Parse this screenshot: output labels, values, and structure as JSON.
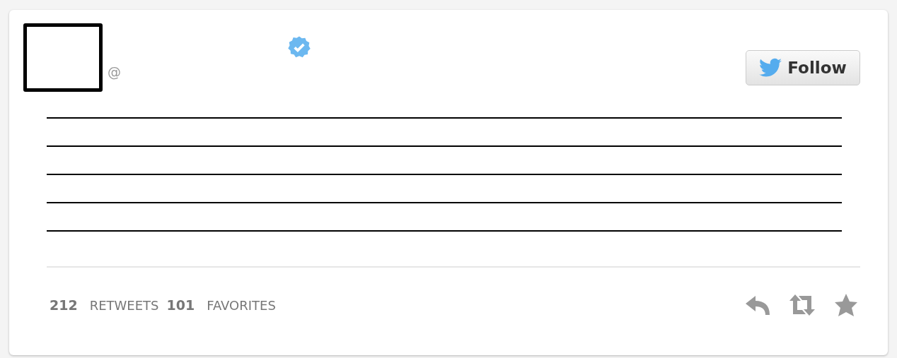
{
  "tweet": {
    "handle": "@",
    "verified": true,
    "follow_button": {
      "label": "Follow"
    },
    "body_lines": [
      {
        "kind": "blank"
      },
      {
        "kind": "blank"
      },
      {
        "kind": "blank"
      },
      {
        "kind": "blank"
      },
      {
        "kind": "blank"
      }
    ],
    "stats": [
      {
        "count": "212",
        "label": "RETWEETS"
      },
      {
        "count": "101",
        "label": "FAVORITES"
      }
    ]
  }
}
